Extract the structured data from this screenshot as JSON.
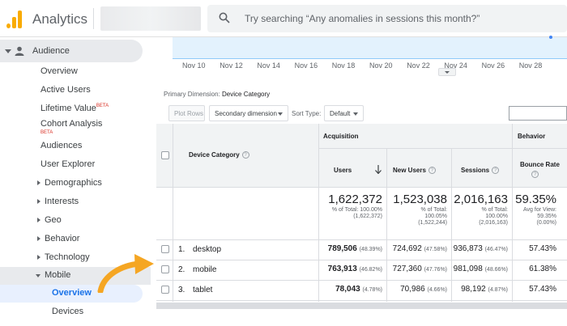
{
  "header": {
    "brand": "Analytics",
    "search_placeholder": "Try searching “Any anomalies in sessions this month?”"
  },
  "sidebar": {
    "audience": "Audience",
    "items": [
      {
        "label": "Overview"
      },
      {
        "label": "Active Users"
      },
      {
        "label": "Lifetime Value",
        "badge": "BETA"
      },
      {
        "label": "Cohort Analysis",
        "badge": "BETA"
      },
      {
        "label": "Audiences"
      },
      {
        "label": "User Explorer"
      },
      {
        "label": "Demographics"
      },
      {
        "label": "Interests"
      },
      {
        "label": "Geo"
      },
      {
        "label": "Behavior"
      },
      {
        "label": "Technology"
      },
      {
        "label": "Mobile"
      },
      {
        "label": "Overview"
      },
      {
        "label": "Devices"
      }
    ]
  },
  "chart": {
    "x_labels": [
      "Nov 10",
      "Nov 12",
      "Nov 14",
      "Nov 16",
      "Nov 18",
      "Nov 20",
      "Nov 22",
      "Nov 24",
      "Nov 26",
      "Nov 28"
    ]
  },
  "toolbar": {
    "primary_dimension_label": "Primary Dimension:",
    "primary_dimension_value": "Device Category",
    "plot_rows": "Plot Rows",
    "secondary_dimension": "Secondary dimension",
    "sort_type_label": "Sort Type:",
    "sort_type_value": "Default"
  },
  "table": {
    "dimension_header": "Device Category",
    "groups": {
      "acquisition": "Acquisition",
      "behavior": "Behavior"
    },
    "columns": {
      "users": "Users",
      "new_users": "New Users",
      "sessions": "Sessions",
      "bounce_rate": "Bounce Rate"
    },
    "totals": {
      "users": {
        "value": "1,622,372",
        "line1": "% of Total: 100.00%",
        "line2": "(1,622,372)"
      },
      "new_users": {
        "value": "1,523,038",
        "line1": "% of Total:",
        "line2": "100.05%",
        "line3": "(1,522,244)"
      },
      "sessions": {
        "value": "2,016,163",
        "line1": "% of Total:",
        "line2": "100.00%",
        "line3": "(2,016,163)"
      },
      "bounce_rate": {
        "value": "59.35%",
        "line1": "Avg for View:",
        "line2": "59.35%",
        "line3": "(0.00%)"
      }
    },
    "rows": [
      {
        "num": "1.",
        "name": "desktop",
        "users": "789,506",
        "users_pct": "(48.39%)",
        "new_users": "724,692",
        "new_users_pct": "(47.58%)",
        "sessions": "936,873",
        "sessions_pct": "(46.47%)",
        "bounce": "57.43%"
      },
      {
        "num": "2.",
        "name": "mobile",
        "users": "763,913",
        "users_pct": "(46.82%)",
        "new_users": "727,360",
        "new_users_pct": "(47.76%)",
        "sessions": "981,098",
        "sessions_pct": "(48.66%)",
        "bounce": "61.38%"
      },
      {
        "num": "3.",
        "name": "tablet",
        "users": "78,043",
        "users_pct": "(4.78%)",
        "new_users": "70,986",
        "new_users_pct": "(4.66%)",
        "sessions": "98,192",
        "sessions_pct": "(4.87%)",
        "bounce": "57.43%"
      }
    ]
  },
  "colors": {
    "brand_orange": "#f9ab00",
    "active_blue": "#1a73e8",
    "annotation_arrow": "#f5a623"
  }
}
